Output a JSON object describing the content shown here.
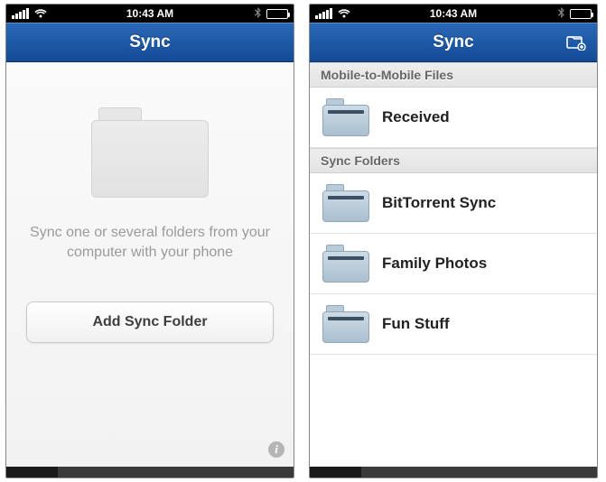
{
  "status": {
    "time": "10:43 AM"
  },
  "screen1": {
    "title": "Sync",
    "empty_message": "Sync one or several folders from your computer with your phone",
    "add_button": "Add Sync Folder"
  },
  "screen2": {
    "title": "Sync",
    "sections": [
      {
        "header": "Mobile-to-Mobile Files",
        "items": [
          {
            "label": "Received"
          }
        ]
      },
      {
        "header": "Sync Folders",
        "items": [
          {
            "label": "BitTorrent Sync"
          },
          {
            "label": "Family Photos"
          },
          {
            "label": "Fun Stuff"
          }
        ]
      }
    ]
  }
}
